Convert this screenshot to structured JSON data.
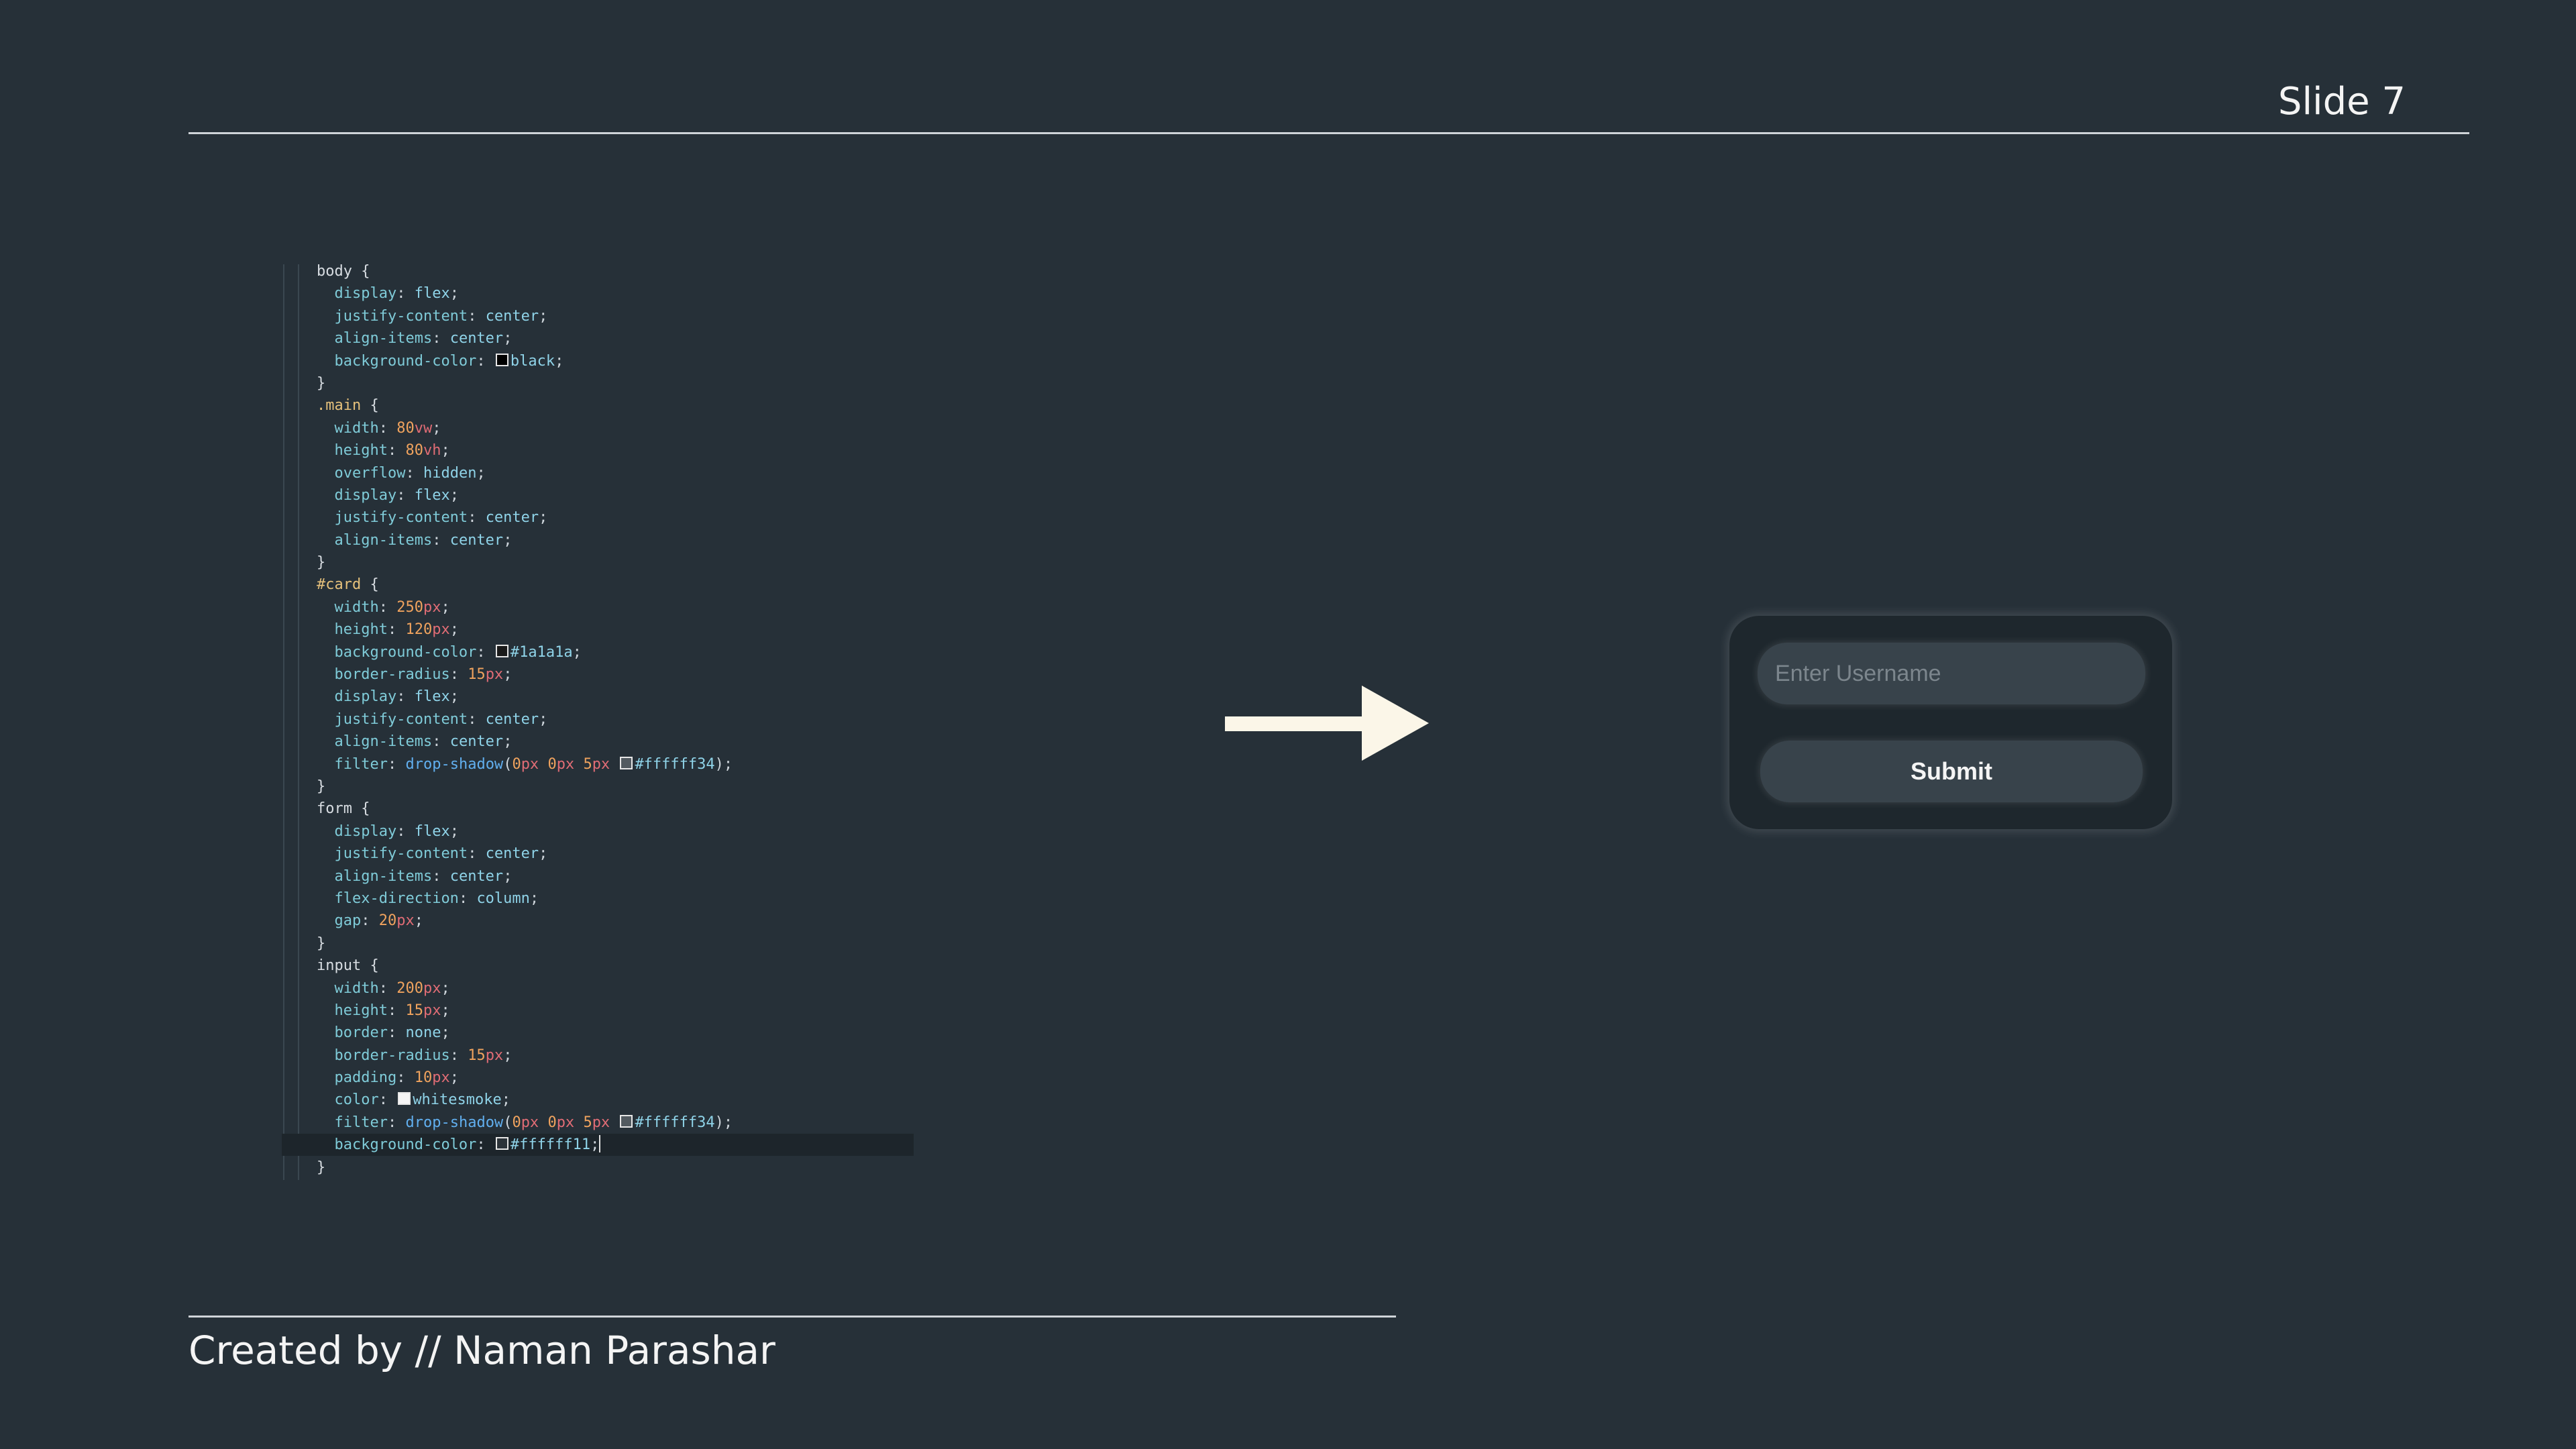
{
  "slide": {
    "title": "Slide 7",
    "credit": "Created by // Naman Parashar"
  },
  "code": {
    "language": "css",
    "lines": [
      "body {",
      "  display: flex;",
      "  justify-content: center;",
      "  align-items: center;",
      "  background-color: black;",
      "}",
      ".main {",
      "  width: 80vw;",
      "  height: 80vh;",
      "  overflow: hidden;",
      "  display: flex;",
      "  justify-content: center;",
      "  align-items: center;",
      "}",
      "#card {",
      "  width: 250px;",
      "  height: 120px;",
      "  background-color: #1a1a1a;",
      "  border-radius: 15px;",
      "  display: flex;",
      "  justify-content: center;",
      "  align-items: center;",
      "  filter: drop-shadow(0px 0px 5px #ffffff34);",
      "}",
      "form {",
      "  display: flex;",
      "  justify-content: center;",
      "  align-items: center;",
      "  flex-direction: column;",
      "  gap: 20px;",
      "}",
      "input {",
      "  width: 200px;",
      "  height: 15px;",
      "  border: none;",
      "  border-radius: 15px;",
      "  padding: 10px;",
      "  color: whitesmoke;",
      "  filter: drop-shadow(0px 0px 5px #ffffff34);",
      "  background-color: #ffffff11;",
      "}"
    ],
    "swatch_colors": {
      "black": "#000000",
      "#1a1a1a": "#1a1a1a",
      "whitesmoke": "#f5f5f5",
      "#ffffff34": "#ffffff34",
      "#ffffff11": "#ffffff11"
    }
  },
  "arrow": {
    "icon": "right-arrow-icon",
    "color": "#fbf6e8"
  },
  "preview": {
    "input_placeholder": "Enter Username",
    "input_value": "",
    "submit_label": "Submit"
  },
  "colors": {
    "background": "#263038",
    "text": "#f4f4f4",
    "card": "#1e272d",
    "field": "#38434b"
  }
}
